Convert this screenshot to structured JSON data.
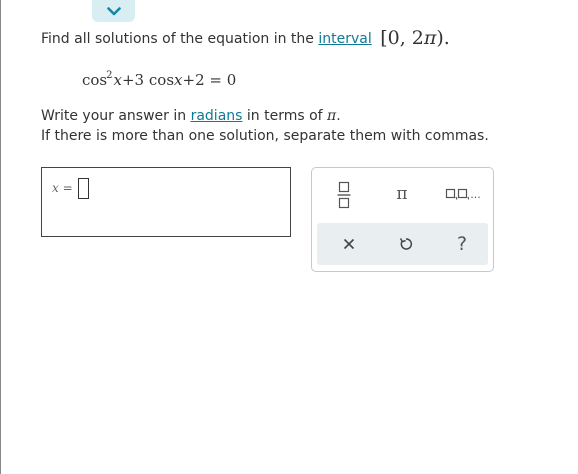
{
  "header": {
    "collapse_icon": "chevron-down-icon"
  },
  "question": {
    "prefix": "Find all solutions of the equation in the",
    "link": "interval",
    "interval": {
      "open": "[",
      "zero": "0,",
      "two": "2",
      "pi": "π",
      "close": ")."
    }
  },
  "equation": {
    "cos1": "cos",
    "exp": "2",
    "x1": "x",
    "plus1": "+3",
    "cos2": "cos",
    "x2": "x",
    "rest": "+2 = 0"
  },
  "instructions": {
    "line1_prefix": "Write your answer in",
    "line1_link": "radians",
    "line1_mid": "in terms of",
    "line1_pi": "π",
    "line1_end": ".",
    "line2": "If there is more than one solution, separate them with commas."
  },
  "answer": {
    "var": "x",
    "eq": "=",
    "value": ""
  },
  "keypad": {
    "fraction_icon": "fraction-icon",
    "pi_label": "π",
    "list_icon": "list-icon",
    "list_suffix": "...",
    "clear_icon": "close-icon",
    "undo_icon": "undo-icon",
    "help_label": "?"
  },
  "colors": {
    "link": "#0f7a95",
    "tab_bg": "#d8eef3",
    "keypad_action_bg": "#e9eff1"
  }
}
